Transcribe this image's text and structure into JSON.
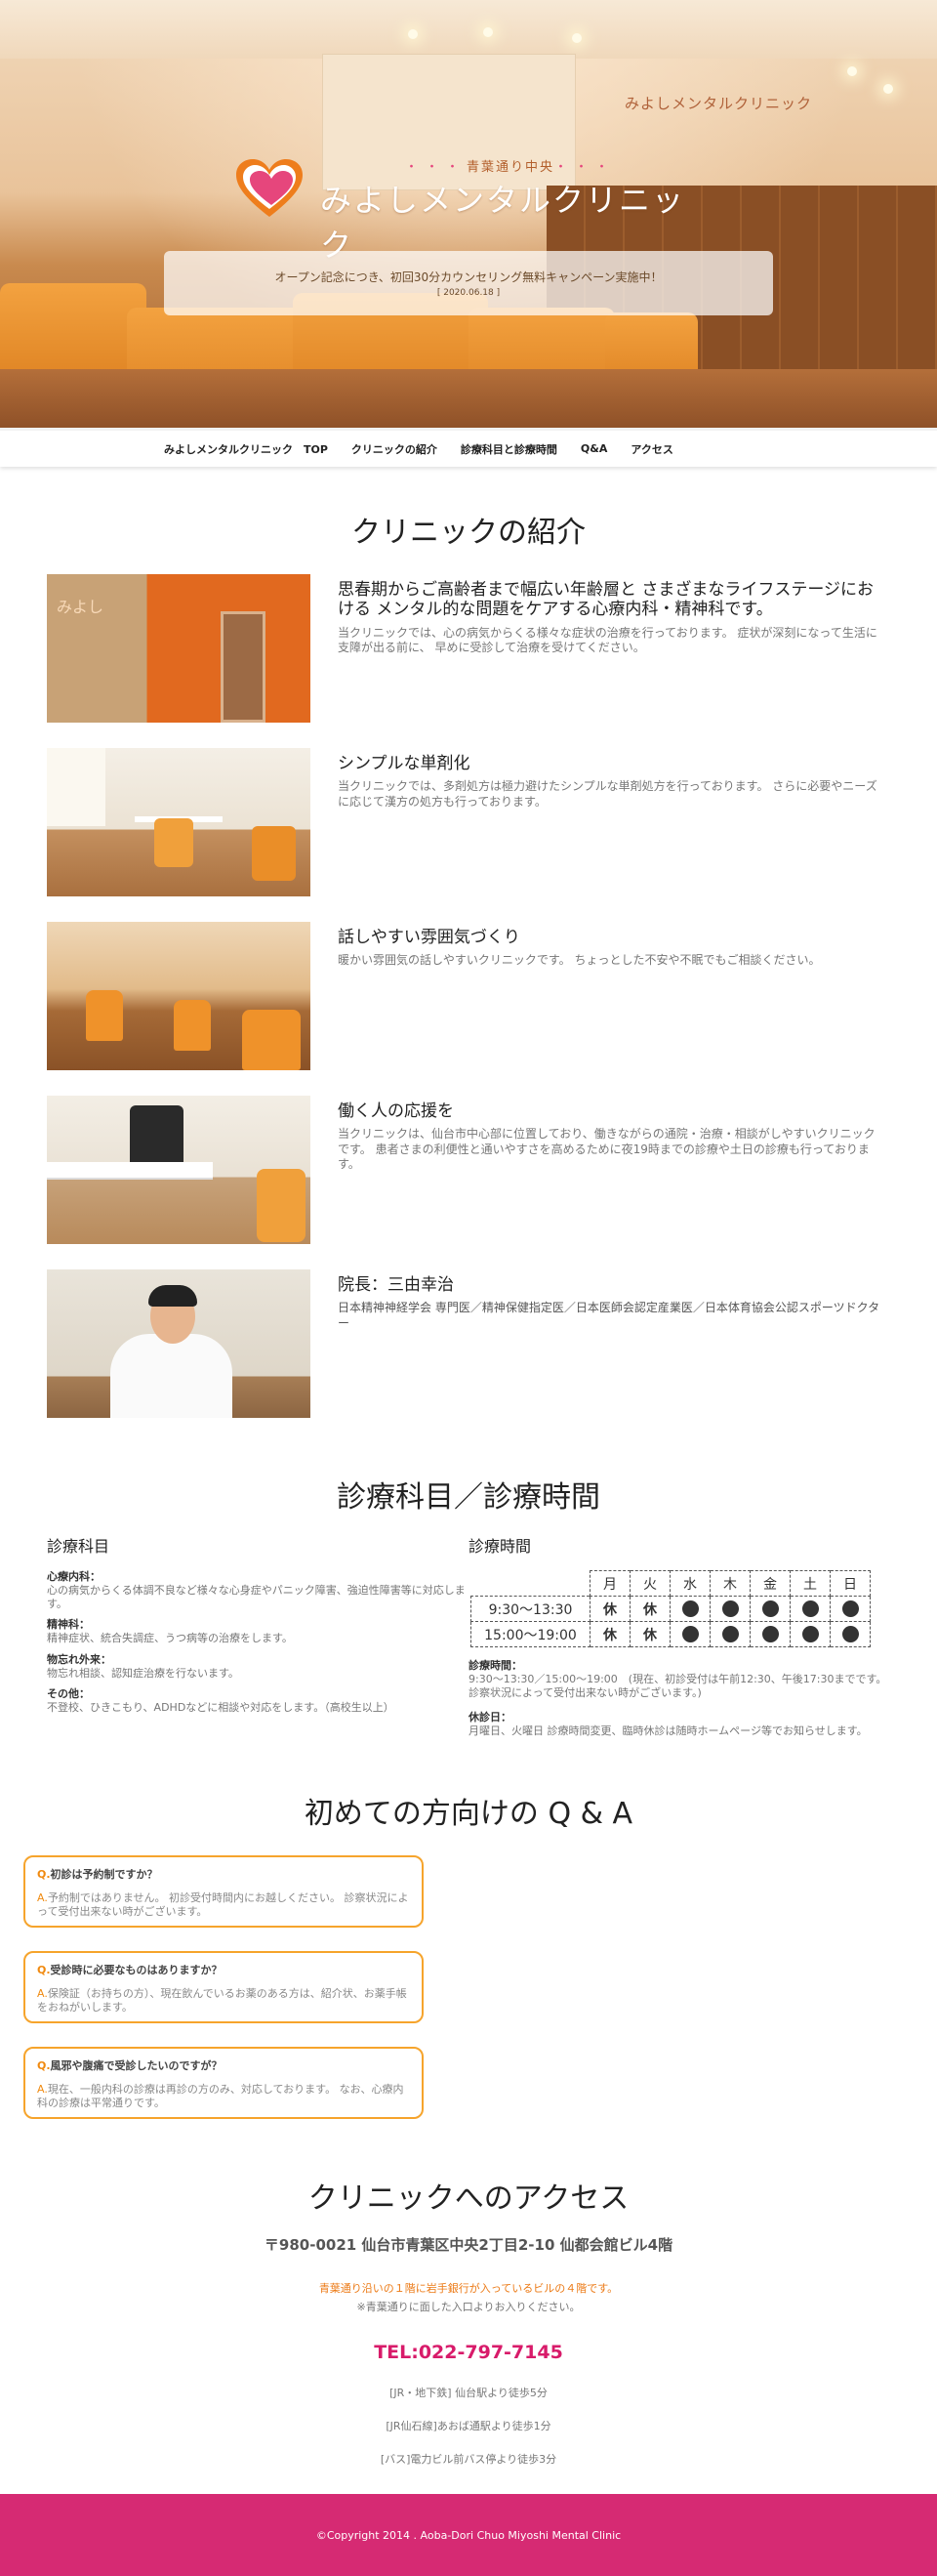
{
  "hero": {
    "logo_sub": "青葉通り中央",
    "logo_name": "みよしメンタルクリニック",
    "wall_sign": "みよしメンタルクリニック",
    "notice_main": "オープン記念につき、初回30分カウンセリング無料キャンペーン実施中！",
    "notice_date": "[ 2020.06.18 ]"
  },
  "nav": {
    "items": [
      "みよしメンタルクリニック　TOP",
      "クリニックの紹介",
      "診療科目と診療時間",
      "Q&A",
      "アクセス"
    ]
  },
  "intro": {
    "title": "クリニックの紹介",
    "rows": [
      {
        "heading": "思春期からご高齢者まで幅広い年齢層と さまざまなライフステージにおける メンタル的な問題をケアする心療内科・精神科です。",
        "body": "当クリニックでは、心の病気からくる様々な症状の治療を行っております。 症状が深刻になって生活に支障が出る前に、 早めに受診して治療を受けてください。"
      },
      {
        "heading": "シンプルな単剤化",
        "body": "当クリニックでは、多剤処方は極力避けたシンプルな単剤処方を行っております。 さらに必要やニーズに応じて漢方の処方も行っております。"
      },
      {
        "heading": "話しやすい雰囲気づくり",
        "body": "暖かい雰囲気の話しやすいクリニックです。 ちょっとした不安や不眠でもご相談ください。"
      },
      {
        "heading": "働く人の応援を",
        "body": "当クリニックは、仙台市中心部に位置しており、働きながらの通院・治療・相談がしやすいクリニックです。 患者さまの利便性と通いやすさを高めるために夜19時までの診療や土日の診療も行っております。"
      },
      {
        "heading": "院長：三由幸治",
        "body": "日本精神神経学会 専門医／精神保健指定医／日本医師会認定産業医／日本体育協会公認スポーツドクター"
      }
    ]
  },
  "schedule": {
    "title": "診療科目／診療時間",
    "dept_heading": "診療科目",
    "depts": [
      {
        "label": "心療内科：",
        "text": "心の病気からくる体調不良など様々な心身症やパニック障害、強迫性障害等に対応します。"
      },
      {
        "label": "精神科：",
        "text": "精神症状、統合失調症、うつ病等の治療をします。"
      },
      {
        "label": "物忘れ外来：",
        "text": "物忘れ相談、認知症治療を行ないます。"
      },
      {
        "label": "その他：",
        "text": "不登校、ひきこもり、ADHDなどに相談や対応をします。（高校生以上）"
      }
    ],
    "hours_heading": "診療時間",
    "days": [
      "月",
      "火",
      "水",
      "木",
      "金",
      "土",
      "日"
    ],
    "slots": [
      {
        "time": "9:30〜13:30",
        "status": [
          "休",
          "休",
          "●",
          "●",
          "●",
          "●",
          "●"
        ]
      },
      {
        "time": "15:00〜19:00",
        "status": [
          "休",
          "休",
          "●",
          "●",
          "●",
          "●",
          "●"
        ]
      }
    ],
    "hours_note_label": "診療時間：",
    "hours_note": "9:30〜13:30／15:00〜19:00　(現在、初診受付は午前12:30、午後17:30までです。 診察状況によって受付出来ない時がございます。)",
    "holiday_label": "休診日：",
    "holiday_note": "月曜日、火曜日 診療時間変更、臨時休診は随時ホームページ等でお知らせします。"
  },
  "qa": {
    "title": "初めての方向けの Q & A",
    "items": [
      {
        "q": "初診は予約制ですか？",
        "a": "予約制ではありません。 初診受付時間内にお越しください。 診察状況によって受付出来ない時がございます。"
      },
      {
        "q": "受診時に必要なものはありますか？",
        "a": "保険証（お持ちの方）、現在飲んでいるお薬のある方は、紹介状、お薬手帳をおねがいします。"
      },
      {
        "q": "風邪や腹痛で受診したいのですが？",
        "a": "現在、一般内科の診療は再診の方のみ、対応しております。 なお、心療内科の診療は平常通りです。"
      }
    ],
    "q_mark": "Q.",
    "a_mark": "A."
  },
  "access": {
    "title": "クリニックへのアクセス",
    "address": "〒980-0021 仙台市青葉区中央2丁目2-10 仙都会館ビル4階",
    "building_note": "青葉通り沿いの１階に岩手銀行が入っているビルの４階です。",
    "entrance_note": "※青葉通りに面した入口よりお入りください。",
    "tel": "TEL:022-797-7145",
    "routes": [
      "[JR・地下鉄] 仙台駅より徒歩5分",
      "[JR仙石線]あおば通駅より徒歩1分",
      "[バス]電力ビル前バス停より徒歩3分"
    ]
  },
  "footer": {
    "copyright": "©Copyright 2014 . Aoba-Dori Chuo Miyoshi Mental Clinic"
  },
  "colors": {
    "accent_orange": "#f6a42c",
    "tel_pink": "#d81b6a",
    "footer_pink": "#d62a73"
  }
}
